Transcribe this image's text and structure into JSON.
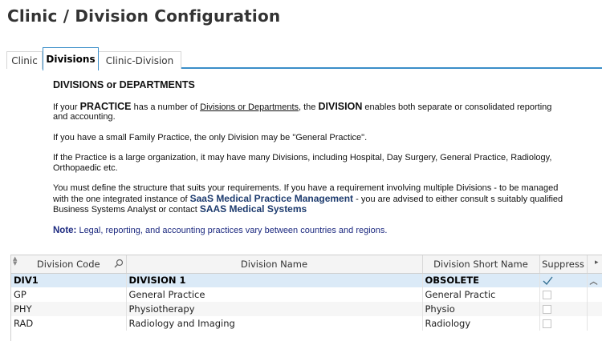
{
  "page": {
    "title": "Clinic / Division Configuration"
  },
  "tabs": [
    {
      "label": "Clinic",
      "active": false
    },
    {
      "label": "Divisions",
      "active": true
    },
    {
      "label": "Clinic-Division",
      "active": false
    }
  ],
  "info": {
    "heading": "DIVISIONS or DEPARTMENTS",
    "p1": {
      "a": "If your ",
      "b": "PRACTICE",
      "c": " has a number of ",
      "link": "Divisions or Departments",
      "d": ", the ",
      "e": "DIVISION",
      "f": " enables both separate or consolidated reporting and accounting."
    },
    "p2": "If you have a small Family Practice, the only Division may be \"General Practice\".",
    "p3": "If the Practice is a large organization, it may have many Divisions, including Hospital, Day Surgery, General Practice, Radiology, Orthopaedic etc.",
    "p4": {
      "a": "You must define the structure that suits your requirements. If you have a requirement involving multiple Divisions - to be managed with the one integrated instance of ",
      "brand1": "SaaS Medical Practice Management",
      "b": " - you are advised to either consult s suitably qualified Business Systems Analyst or contact ",
      "brand2": "SAAS Medical Systems"
    },
    "note": {
      "label": "Note:",
      "text": " Legal, reporting, and accounting practices vary between countries and regions."
    }
  },
  "grid": {
    "columns": [
      "Division Code",
      "Division Name",
      "Division Short Name",
      "Suppress"
    ],
    "rows": [
      {
        "code": "DIV1",
        "name": "DIVISION 1",
        "short": "OBSOLETE",
        "suppress": true,
        "selected": true
      },
      {
        "code": "GP",
        "name": "General Practice",
        "short": "General Practic",
        "suppress": false,
        "selected": false
      },
      {
        "code": "PHY",
        "name": "Physiotherapy",
        "short": "Physio",
        "suppress": false,
        "selected": false
      },
      {
        "code": "RAD",
        "name": "Radiology and Imaging",
        "short": "Radiology",
        "suppress": false,
        "selected": false
      }
    ]
  },
  "colors": {
    "accent": "#3a8ec8",
    "selected_row": "#dbeaf7",
    "brand_text": "#1d3b6e"
  }
}
